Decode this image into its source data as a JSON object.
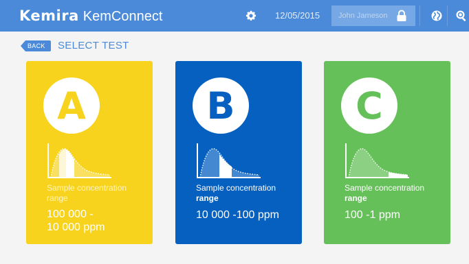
{
  "header": {
    "brand_logo": "Kemira",
    "brand_app": "KemConnect",
    "date": "12/05/2015",
    "user_name": "John Jameson",
    "icons": [
      "gear-icon",
      "lock-icon",
      "globe-icon",
      "zoom-icon"
    ]
  },
  "nav": {
    "back_label": "BACK",
    "page_title": "SELECT TEST"
  },
  "cards": [
    {
      "letter": "A",
      "label_line1": "Sample concentration",
      "label_line2": "range",
      "range": "100 000 -",
      "range_line2": "10 000 ppm",
      "color": "#f7d31e"
    },
    {
      "letter": "B",
      "label_line1": "Sample concentration",
      "label_line2": "range",
      "range": "10 000 -100 ppm",
      "range_line2": "",
      "color": "#0560c0"
    },
    {
      "letter": "C",
      "label_line1": "Sample concentration",
      "label_line2": "range",
      "range": "100 -1 ppm",
      "range_line2": "",
      "color": "#66c05a"
    }
  ],
  "colors": {
    "header_bg": "#4a8ad9",
    "page_bg": "#f4f4f4",
    "accent": "#4a8ad9"
  }
}
